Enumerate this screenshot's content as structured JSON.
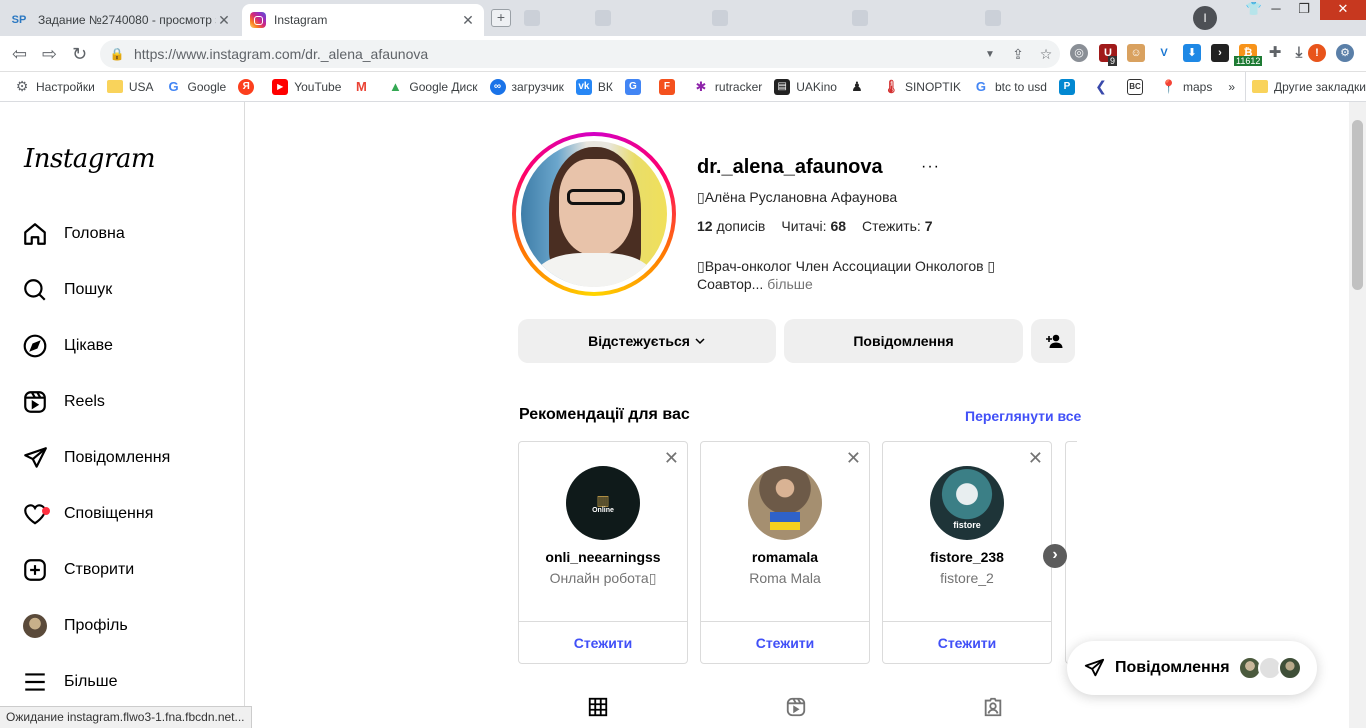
{
  "browser": {
    "tabs": [
      {
        "title": "Задание №2740080 - просмотр з",
        "favicon": "SP",
        "active": false
      },
      {
        "title": "Instagram",
        "favicon": "instagram-icon",
        "active": true
      }
    ],
    "profile_initial": "I",
    "url": "https://www.instagram.com/dr._alena_afaunova",
    "extension_badges": {
      "badge_9": "9",
      "badge_11612": "11612"
    },
    "bookmarks": [
      {
        "label": "Настройки",
        "icon": "gear-icon"
      },
      {
        "label": "USA",
        "icon": "folder-icon"
      },
      {
        "label": "Google",
        "icon": "google-icon"
      },
      {
        "label": "",
        "icon": "yandex-icon"
      },
      {
        "label": "YouTube",
        "icon": "youtube-icon"
      },
      {
        "label": "",
        "icon": "gmail-icon"
      },
      {
        "label": "Google Диск",
        "icon": "drive-icon"
      },
      {
        "label": "загрузчик",
        "icon": "infinity-icon"
      },
      {
        "label": "ВК",
        "icon": "vk-icon"
      },
      {
        "label": "",
        "icon": "translate-icon"
      },
      {
        "label": "",
        "icon": "f-icon"
      },
      {
        "label": "rutracker",
        "icon": "rutracker-icon"
      },
      {
        "label": "UAKino",
        "icon": "uakino-icon"
      },
      {
        "label": "",
        "icon": "pawn-icon"
      },
      {
        "label": "SINOPTIK",
        "icon": "thermometer-icon"
      },
      {
        "label": "btc to usd",
        "icon": "google-icon"
      },
      {
        "label": "",
        "icon": "p-icon"
      },
      {
        "label": "",
        "icon": "arrow-icon"
      },
      {
        "label": "",
        "icon": "bc-icon"
      },
      {
        "label": "maps",
        "icon": "maps-icon"
      }
    ],
    "bookmarks_more": "»",
    "other_bookmarks": "Другие закладки",
    "status_text": "Ожидание instagram.flwo3-1.fna.fbcdn.net..."
  },
  "sidebar": {
    "logo": "Instagram",
    "items": [
      {
        "label": "Головна",
        "icon": "home-icon"
      },
      {
        "label": "Пошук",
        "icon": "search-icon"
      },
      {
        "label": "Цікаве",
        "icon": "compass-icon"
      },
      {
        "label": "Reels",
        "icon": "reels-icon"
      },
      {
        "label": "Повідомлення",
        "icon": "messenger-icon"
      },
      {
        "label": "Сповіщення",
        "icon": "heart-icon"
      },
      {
        "label": "Створити",
        "icon": "plus-square-icon"
      },
      {
        "label": "Профіль",
        "icon": "avatar-icon"
      },
      {
        "label": "Більше",
        "icon": "menu-icon"
      }
    ]
  },
  "profile": {
    "username": "dr._alena_afaunova",
    "more": "···",
    "full_name": "Алёна Руслановна Афаунова",
    "stats": {
      "posts_label": "дописів",
      "posts": "12",
      "followers_label": "Читачі:",
      "followers": "68",
      "following_label": "Стежить:",
      "following": "7"
    },
    "bio_line1": "Врач-онколог Член Ассоциации Онкологов",
    "bio_line2": "Соавтор...",
    "bio_more": "більше",
    "buttons": {
      "following": "Відстежується",
      "message": "Повідомлення"
    }
  },
  "recommendations": {
    "title": "Рекомендації для вас",
    "see_all": "Переглянути все",
    "follow_label": "Стежити",
    "cards": [
      {
        "username": "onli_neearningss",
        "subtitle": "Онлайн робота"
      },
      {
        "username": "romamala",
        "subtitle": "Roma Mala"
      },
      {
        "username": "fistore_238",
        "subtitle": "fistore_2"
      }
    ]
  },
  "floating_messages": {
    "label": "Повідомлення"
  },
  "colors": {
    "link_blue": "#4150f7",
    "notif_red": "#ff3040",
    "win_close": "#c7381f"
  }
}
